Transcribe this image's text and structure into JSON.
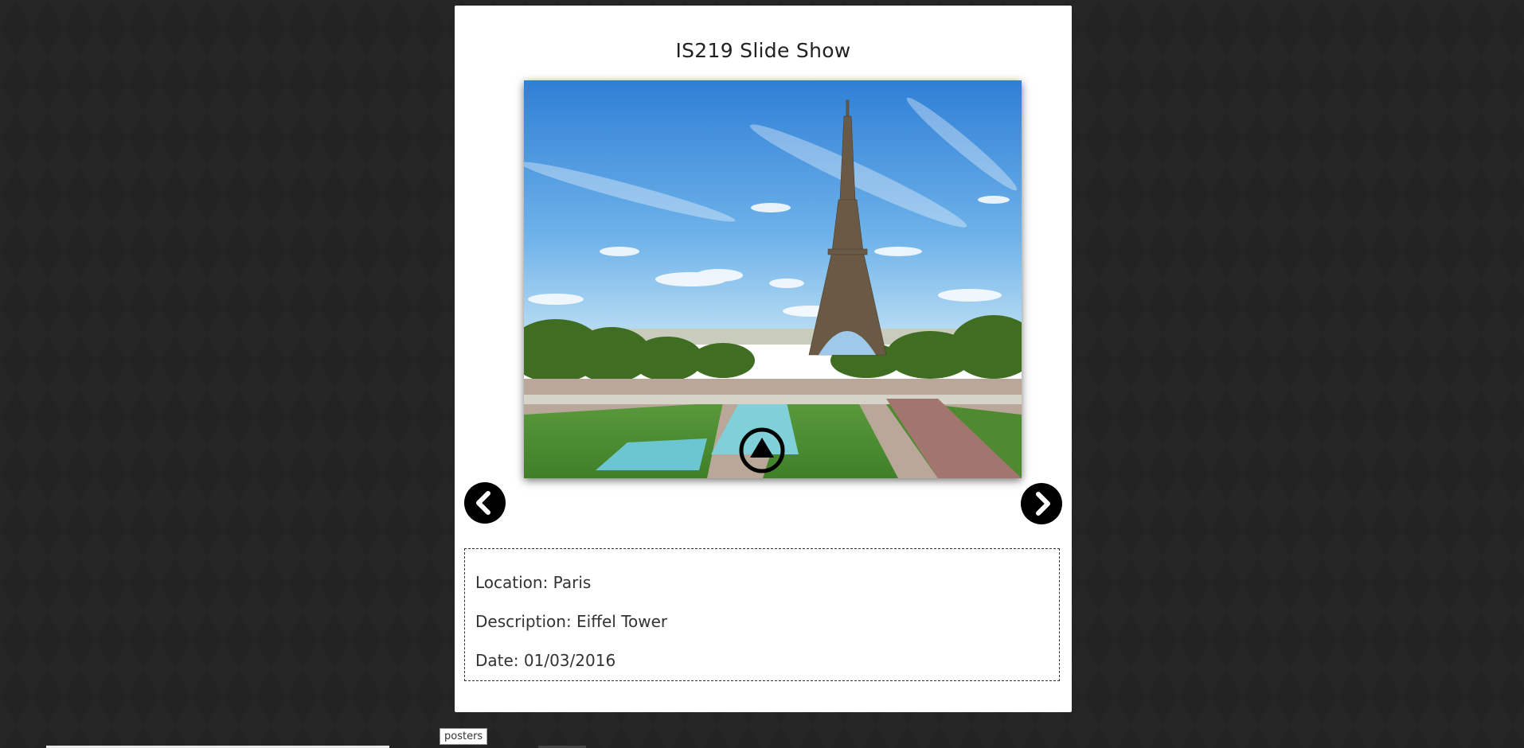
{
  "slideshow": {
    "title": "IS219 Slide Show",
    "photo": {
      "subject": "Eiffel Tower, Paris",
      "icons": {
        "play": "play-circle-icon",
        "prev": "chevron-left-icon",
        "next": "chevron-right-icon"
      }
    },
    "info": {
      "location": "Location: Paris",
      "description": "Description: Eiffel Tower",
      "date": "Date: 01/03/2016"
    }
  },
  "tooltip": {
    "label": "posters"
  },
  "colors": {
    "page_background": "#232323",
    "card_background": "#ffffff",
    "button_background": "#000000"
  }
}
